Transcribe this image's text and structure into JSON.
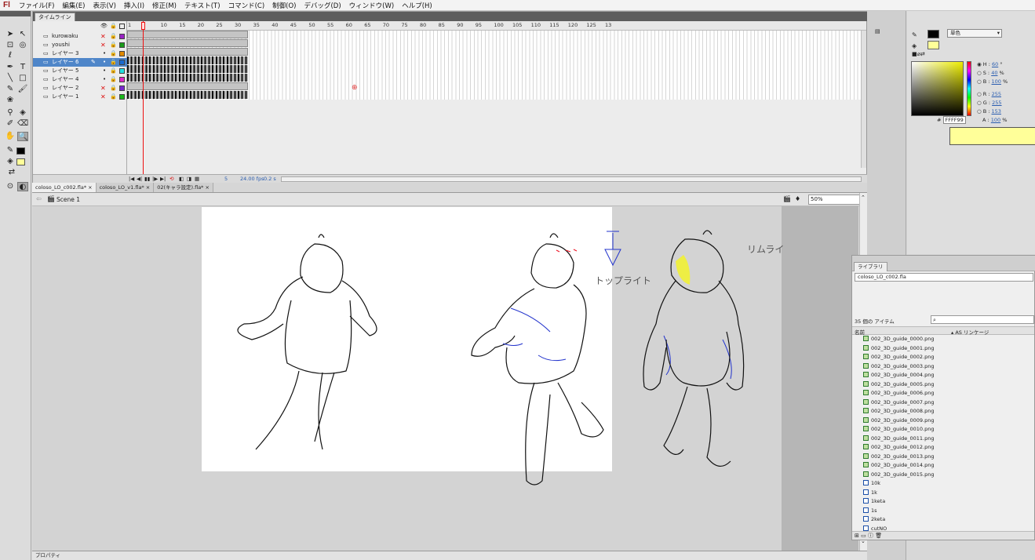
{
  "app": {
    "logo": "Fl"
  },
  "menu": [
    "ファイル(F)",
    "編集(E)",
    "表示(V)",
    "挿入(I)",
    "修正(M)",
    "テキスト(T)",
    "コマンド(C)",
    "制御(O)",
    "デバッグ(D)",
    "ウィンドウ(W)",
    "ヘルプ(H)"
  ],
  "timeline": {
    "tab": "タイムライン",
    "ruler": [
      "1",
      "5",
      "10",
      "15",
      "20",
      "25",
      "30",
      "35",
      "40",
      "45",
      "50",
      "55",
      "60",
      "65",
      "70",
      "75",
      "80",
      "85",
      "90",
      "95",
      "100",
      "105",
      "110",
      "115",
      "120",
      "125",
      "13"
    ],
    "layers": [
      {
        "name": "kurowaku",
        "hidden": true,
        "color": "#9a22c4"
      },
      {
        "name": "youshi",
        "hidden": true,
        "color": "#1a9a1a"
      },
      {
        "name": "レイヤー 3",
        "hidden": false,
        "color": "#e28a00"
      },
      {
        "name": "レイヤー 6",
        "hidden": false,
        "color": "#1a6acf",
        "selected": true
      },
      {
        "name": "レイヤー 5",
        "hidden": false,
        "color": "#22e0e0"
      },
      {
        "name": "レイヤー 4",
        "hidden": false,
        "color": "#e028c8"
      },
      {
        "name": "レイヤー 2",
        "hidden": true,
        "color": "#7a28cf"
      },
      {
        "name": "レイヤー 1",
        "hidden": true,
        "color": "#1ab81a"
      }
    ],
    "status": {
      "frame": "5",
      "fps": "24.00 fps",
      "time": "0.2 s"
    }
  },
  "doc_tabs": [
    "coloso_LO_c002.fla*",
    "coloso_LO_v1.fla*",
    "02(キャラ設定).fla*"
  ],
  "editbar": {
    "scene": "Scene 1",
    "zoom": "50%"
  },
  "stage": {
    "labels": {
      "toplight": "トップライト",
      "rimlight": "リムライ"
    }
  },
  "properties_label": "プロパティ",
  "color": {
    "type": "単色",
    "hex": "FFFF99",
    "h": "60",
    "s": "40",
    "b": "100",
    "r": "255",
    "g": "255",
    "bb": "153",
    "alpha": "100",
    "accent_fill": "#ffff99",
    "stroke_color": "#000000"
  },
  "library": {
    "title": "ライブラリ",
    "file": "coloso_LO_c002.fla",
    "count_label": "35 個の アイテム",
    "col_name": "名前",
    "col_linkage": "AS リンケージ",
    "items": [
      {
        "name": "002_3D_guide_0000.png",
        "kind": "bitmap"
      },
      {
        "name": "002_3D_guide_0001.png",
        "kind": "bitmap"
      },
      {
        "name": "002_3D_guide_0002.png",
        "kind": "bitmap"
      },
      {
        "name": "002_3D_guide_0003.png",
        "kind": "bitmap"
      },
      {
        "name": "002_3D_guide_0004.png",
        "kind": "bitmap"
      },
      {
        "name": "002_3D_guide_0005.png",
        "kind": "bitmap"
      },
      {
        "name": "002_3D_guide_0006.png",
        "kind": "bitmap"
      },
      {
        "name": "002_3D_guide_0007.png",
        "kind": "bitmap"
      },
      {
        "name": "002_3D_guide_0008.png",
        "kind": "bitmap"
      },
      {
        "name": "002_3D_guide_0009.png",
        "kind": "bitmap"
      },
      {
        "name": "002_3D_guide_0010.png",
        "kind": "bitmap"
      },
      {
        "name": "002_3D_guide_0011.png",
        "kind": "bitmap"
      },
      {
        "name": "002_3D_guide_0012.png",
        "kind": "bitmap"
      },
      {
        "name": "002_3D_guide_0013.png",
        "kind": "bitmap"
      },
      {
        "name": "002_3D_guide_0014.png",
        "kind": "bitmap"
      },
      {
        "name": "002_3D_guide_0015.png",
        "kind": "bitmap"
      },
      {
        "name": "10k",
        "kind": "symbol"
      },
      {
        "name": "1k",
        "kind": "symbol"
      },
      {
        "name": "1keta",
        "kind": "symbol"
      },
      {
        "name": "1s",
        "kind": "symbol"
      },
      {
        "name": "2keta",
        "kind": "symbol"
      },
      {
        "name": "cutNO",
        "kind": "symbol"
      }
    ]
  }
}
